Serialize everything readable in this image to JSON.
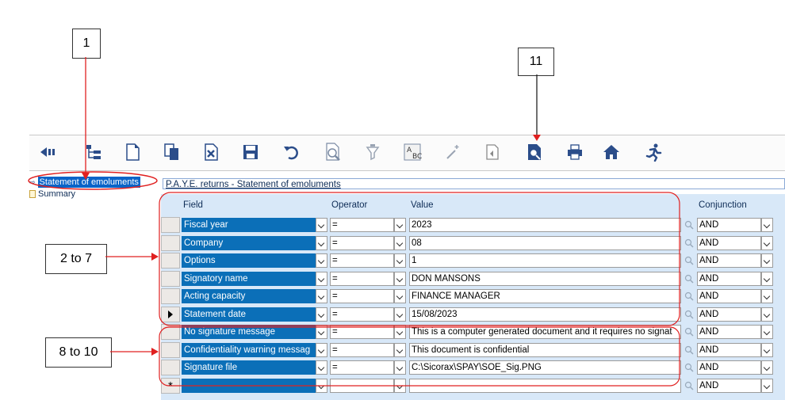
{
  "callouts": {
    "one": "1",
    "eleven": "11",
    "two_to_seven": "2 to 7",
    "eight_to_ten": "8 to 10"
  },
  "toolbar": {
    "icons": [
      "back-arrow-icon",
      "tree-structure-icon",
      "new-document-icon",
      "copy-document-icon",
      "delete-document-icon",
      "save-disk-icon",
      "undo-icon",
      "print-preview-icon",
      "funnel-filter-icon",
      "spell-check-icon",
      "magic-wand-icon",
      "export-icon",
      "report-preview-icon",
      "printer-icon",
      "home-icon",
      "exit-running-man-icon"
    ]
  },
  "tree": {
    "items": [
      {
        "label": "Statement of emoluments",
        "selected": true
      },
      {
        "label": "Summary",
        "selected": false
      }
    ]
  },
  "panel": {
    "title": "P.A.Y.E. returns - Statement of emoluments"
  },
  "grid": {
    "headers": {
      "field": "Field",
      "operator": "Operator",
      "value": "Value",
      "conjunction": "Conjunction"
    },
    "rows": [
      {
        "field": "Fiscal year",
        "operator": "=",
        "value": "2023",
        "conjunction": "AND"
      },
      {
        "field": "Company",
        "operator": "=",
        "value": "08",
        "conjunction": "AND"
      },
      {
        "field": "Options",
        "operator": "=",
        "value": "1",
        "conjunction": "AND"
      },
      {
        "field": "Signatory name",
        "operator": "=",
        "value": "DON MANSONS",
        "conjunction": "AND"
      },
      {
        "field": "Acting capacity",
        "operator": "=",
        "value": "FINANCE MANAGER",
        "conjunction": "AND"
      },
      {
        "field": "Statement date",
        "operator": "=",
        "value": "15/08/2023",
        "conjunction": "AND"
      },
      {
        "field": "No signature message",
        "operator": "=",
        "value": "This is a computer generated document and it requires no signat",
        "conjunction": "AND"
      },
      {
        "field": "Confidentiality warning messag",
        "operator": "=",
        "value": "This document is confidential",
        "conjunction": "AND"
      },
      {
        "field": "Signature file",
        "operator": "=",
        "value": "C:\\Sicorax\\SPAY\\SOE_Sig.PNG",
        "conjunction": "AND"
      },
      {
        "field": "",
        "operator": "",
        "value": "",
        "conjunction": "AND"
      }
    ],
    "new_row_marker": "*"
  },
  "colors": {
    "field_cell": "#0b6fb8",
    "grid_bg": "#d8e8f8",
    "annotation": "#e02020",
    "tree_selected": "#0a64c8"
  }
}
